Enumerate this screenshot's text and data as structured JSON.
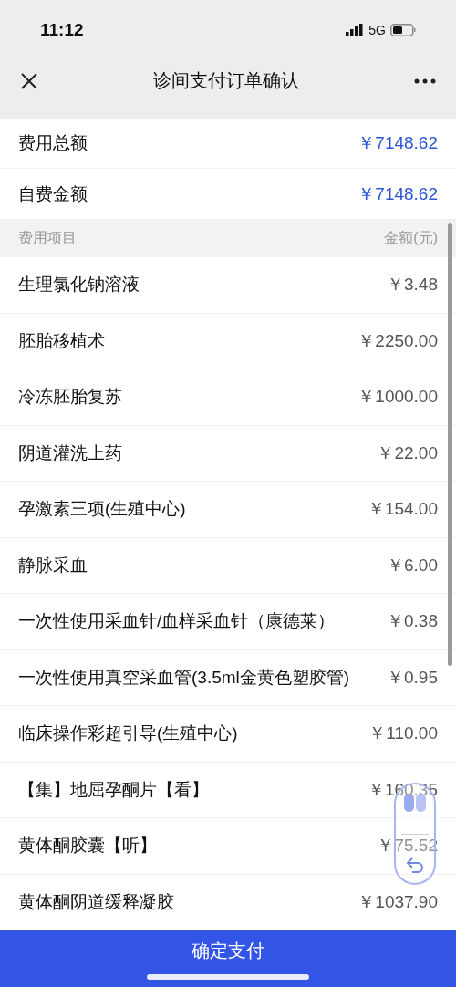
{
  "status_bar": {
    "time": "11:12",
    "network": "5G"
  },
  "nav": {
    "title": "诊间支付订单确认"
  },
  "summary": [
    {
      "label": "费用总额",
      "amount": "￥7148.62"
    },
    {
      "label": "自费金额",
      "amount": "￥7148.62"
    }
  ],
  "items_header": {
    "name_column": "费用项目",
    "amount_column": "金额(元)"
  },
  "items": [
    {
      "name": "生理氯化钠溶液",
      "price": "￥3.48"
    },
    {
      "name": "胚胎移植术",
      "price": "￥2250.00"
    },
    {
      "name": "冷冻胚胎复苏",
      "price": "￥1000.00"
    },
    {
      "name": "阴道灌洗上药",
      "price": "￥22.00"
    },
    {
      "name": "孕激素三项(生殖中心)",
      "price": "￥154.00"
    },
    {
      "name": "静脉采血",
      "price": "￥6.00"
    },
    {
      "name": "一次性使用采血针/血样采血针（康德莱）",
      "price": "￥0.38"
    },
    {
      "name": "一次性使用真空采血管(3.5ml金黄色塑胶管)",
      "price": "￥0.95"
    },
    {
      "name": "临床操作彩超引导(生殖中心)",
      "price": "￥110.00"
    },
    {
      "name": "【集】地屈孕酮片【看】",
      "price": "￥160.35"
    },
    {
      "name": "黄体酮胶囊【听】",
      "price": "￥75.52"
    },
    {
      "name": "黄体酮阴道缓释凝胶",
      "price": "￥1037.90"
    }
  ],
  "pay_button": {
    "label": "确定支付"
  }
}
